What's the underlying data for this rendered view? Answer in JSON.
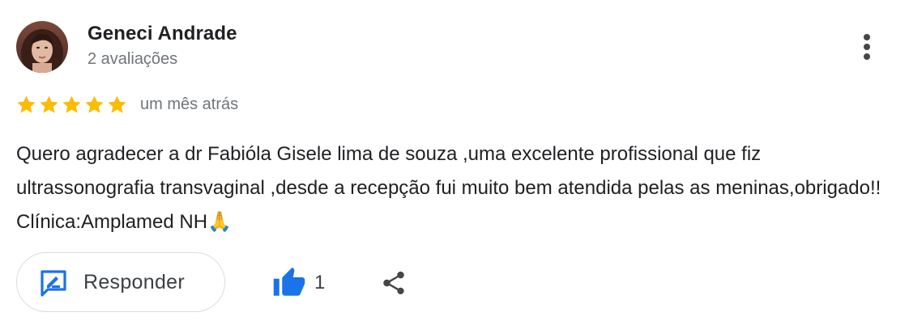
{
  "review": {
    "author": {
      "name": "Geneci Andrade",
      "meta": "2 avaliações"
    },
    "rating": {
      "stars": 5,
      "max": 5,
      "star_color": "#fbbc04"
    },
    "date": "um mês atrás",
    "text": "Quero agradecer a dr Fabióla Gisele lima de souza ,uma excelente profissional que fiz ultrassonografia transvaginal ,desde a recepção fui muito bem atendida pelas as meninas,obrigado!! Clínica:Amplamed NH🙏",
    "actions": {
      "reply_label": "Responder",
      "like_count": "1"
    },
    "icons": {
      "more": "more-vert-icon",
      "reply": "reply-edit-icon",
      "like": "thumb-up-icon",
      "share": "share-icon"
    },
    "colors": {
      "accent": "#1a73e8",
      "secondary_text": "#70757a",
      "border": "#dadce0"
    }
  }
}
